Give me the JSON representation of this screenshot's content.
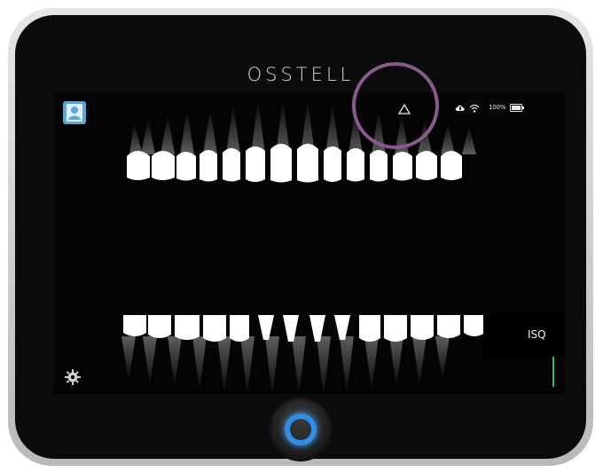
{
  "device": {
    "brand": "OSSTELL"
  },
  "status": {
    "battery_text": "100%",
    "icons": [
      "warning-icon",
      "cloud-icon",
      "wifi-icon",
      "battery-icon"
    ]
  },
  "panel": {
    "isq_label": "ISQ"
  },
  "colors": {
    "accent": "#2f8fe6",
    "highlight": "#8a5a8f",
    "patient_icon": "#5aa7d8",
    "isq_indicator": "#29c06a"
  }
}
